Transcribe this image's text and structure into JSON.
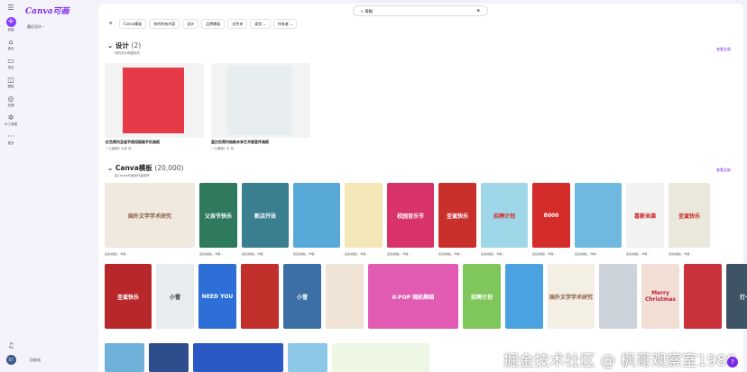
{
  "app": {
    "logo": "Canva可画",
    "recent": "最近设计 ›",
    "trash": "回收站",
    "avatar": "ST"
  },
  "rail": [
    {
      "icon": "⌂",
      "label": "首页"
    },
    {
      "icon": "▭",
      "label": "项目"
    },
    {
      "icon": "◫",
      "label": "模板"
    },
    {
      "icon": "◎",
      "label": "品牌"
    },
    {
      "icon": "✲",
      "label": "AI工具箱"
    },
    {
      "icon": "···",
      "label": "更多"
    }
  ],
  "create_label": "创建",
  "search": {
    "value": "海报",
    "clear": "⊗"
  },
  "toolbar": [
    "Canva模板",
    "你的所有内容",
    "设计",
    "品牌模板",
    "文件夹",
    "类别 ⌄",
    "所有者 ⌄"
  ],
  "designs": {
    "title": "设计",
    "count": "(2)",
    "subtitle": "你的设计和团队的",
    "view_all": "查看全部",
    "cards": [
      {
        "title": "红色简约圣诞节使用插画手机海报",
        "meta": "• 已编辑5 分钟 前"
      },
      {
        "title": "蓝白色简约抽象未来艺术展宣传海报",
        "meta": "• 已编辑1 月 前"
      }
    ]
  },
  "templates": {
    "title": "Canva模板",
    "count": "(20,000)",
    "subtitle": "由Canva可画创作者制作",
    "view_all": "查看全部",
    "row1": [
      {
        "t": "国外文学学术研究",
        "c": "#efe9df",
        "f": "#8a5a44"
      },
      {
        "t": "父亲节快乐",
        "c": "#2f7a5c"
      },
      {
        "t": "新店开张",
        "c": "#3a7f8f"
      },
      {
        "t": "",
        "c": "#58a8d8"
      },
      {
        "t": "",
        "c": "#f4e7b7",
        "f": "#b5472f"
      },
      {
        "t": "校园音乐节",
        "c": "#d8336b"
      },
      {
        "t": "圣诞快乐",
        "c": "#c9302c"
      },
      {
        "t": "招聘计划",
        "c": "#9fd6e8",
        "f": "#d12b2b"
      },
      {
        "t": "8000",
        "c": "#d42b2b"
      },
      {
        "t": "",
        "c": "#6fb8e0"
      },
      {
        "t": "喜薪来袭",
        "c": "#f2f2f2",
        "f": "#c92323"
      },
      {
        "t": "圣诞快乐",
        "c": "#eae8dc",
        "f": "#c92323"
      }
    ],
    "row1_caption": "来自(模板)，作者…",
    "row2": [
      {
        "t": "圣诞快乐",
        "c": "#b8282a"
      },
      {
        "t": "小雪",
        "c": "#e9ecef",
        "f": "#333"
      },
      {
        "t": "NEED YOU",
        "c": "#2d6fd6"
      },
      {
        "t": "",
        "c": "#c2302c"
      },
      {
        "t": "小雪",
        "c": "#3b6fa6"
      },
      {
        "t": "",
        "c": "#f0e4d6",
        "f": "#b13"
      },
      {
        "t": "K-POP 随机舞蹈",
        "c": "#e25bb3"
      },
      {
        "t": "招聘计划",
        "c": "#7fc65b"
      },
      {
        "t": "",
        "c": "#4aa3e0"
      },
      {
        "t": "国外文学学术研究",
        "c": "#f4efe5",
        "f": "#8a5a44"
      },
      {
        "t": "",
        "c": "#ccd3da"
      },
      {
        "t": "Merry Christmas",
        "c": "#f1dfd6",
        "f": "#b23"
      },
      {
        "t": "",
        "c": "#c9323a"
      },
      {
        "t": "打卡",
        "c": "#3e5363"
      }
    ]
  },
  "watermark": "掘金技术社区 @ 枫哥观察室1988"
}
